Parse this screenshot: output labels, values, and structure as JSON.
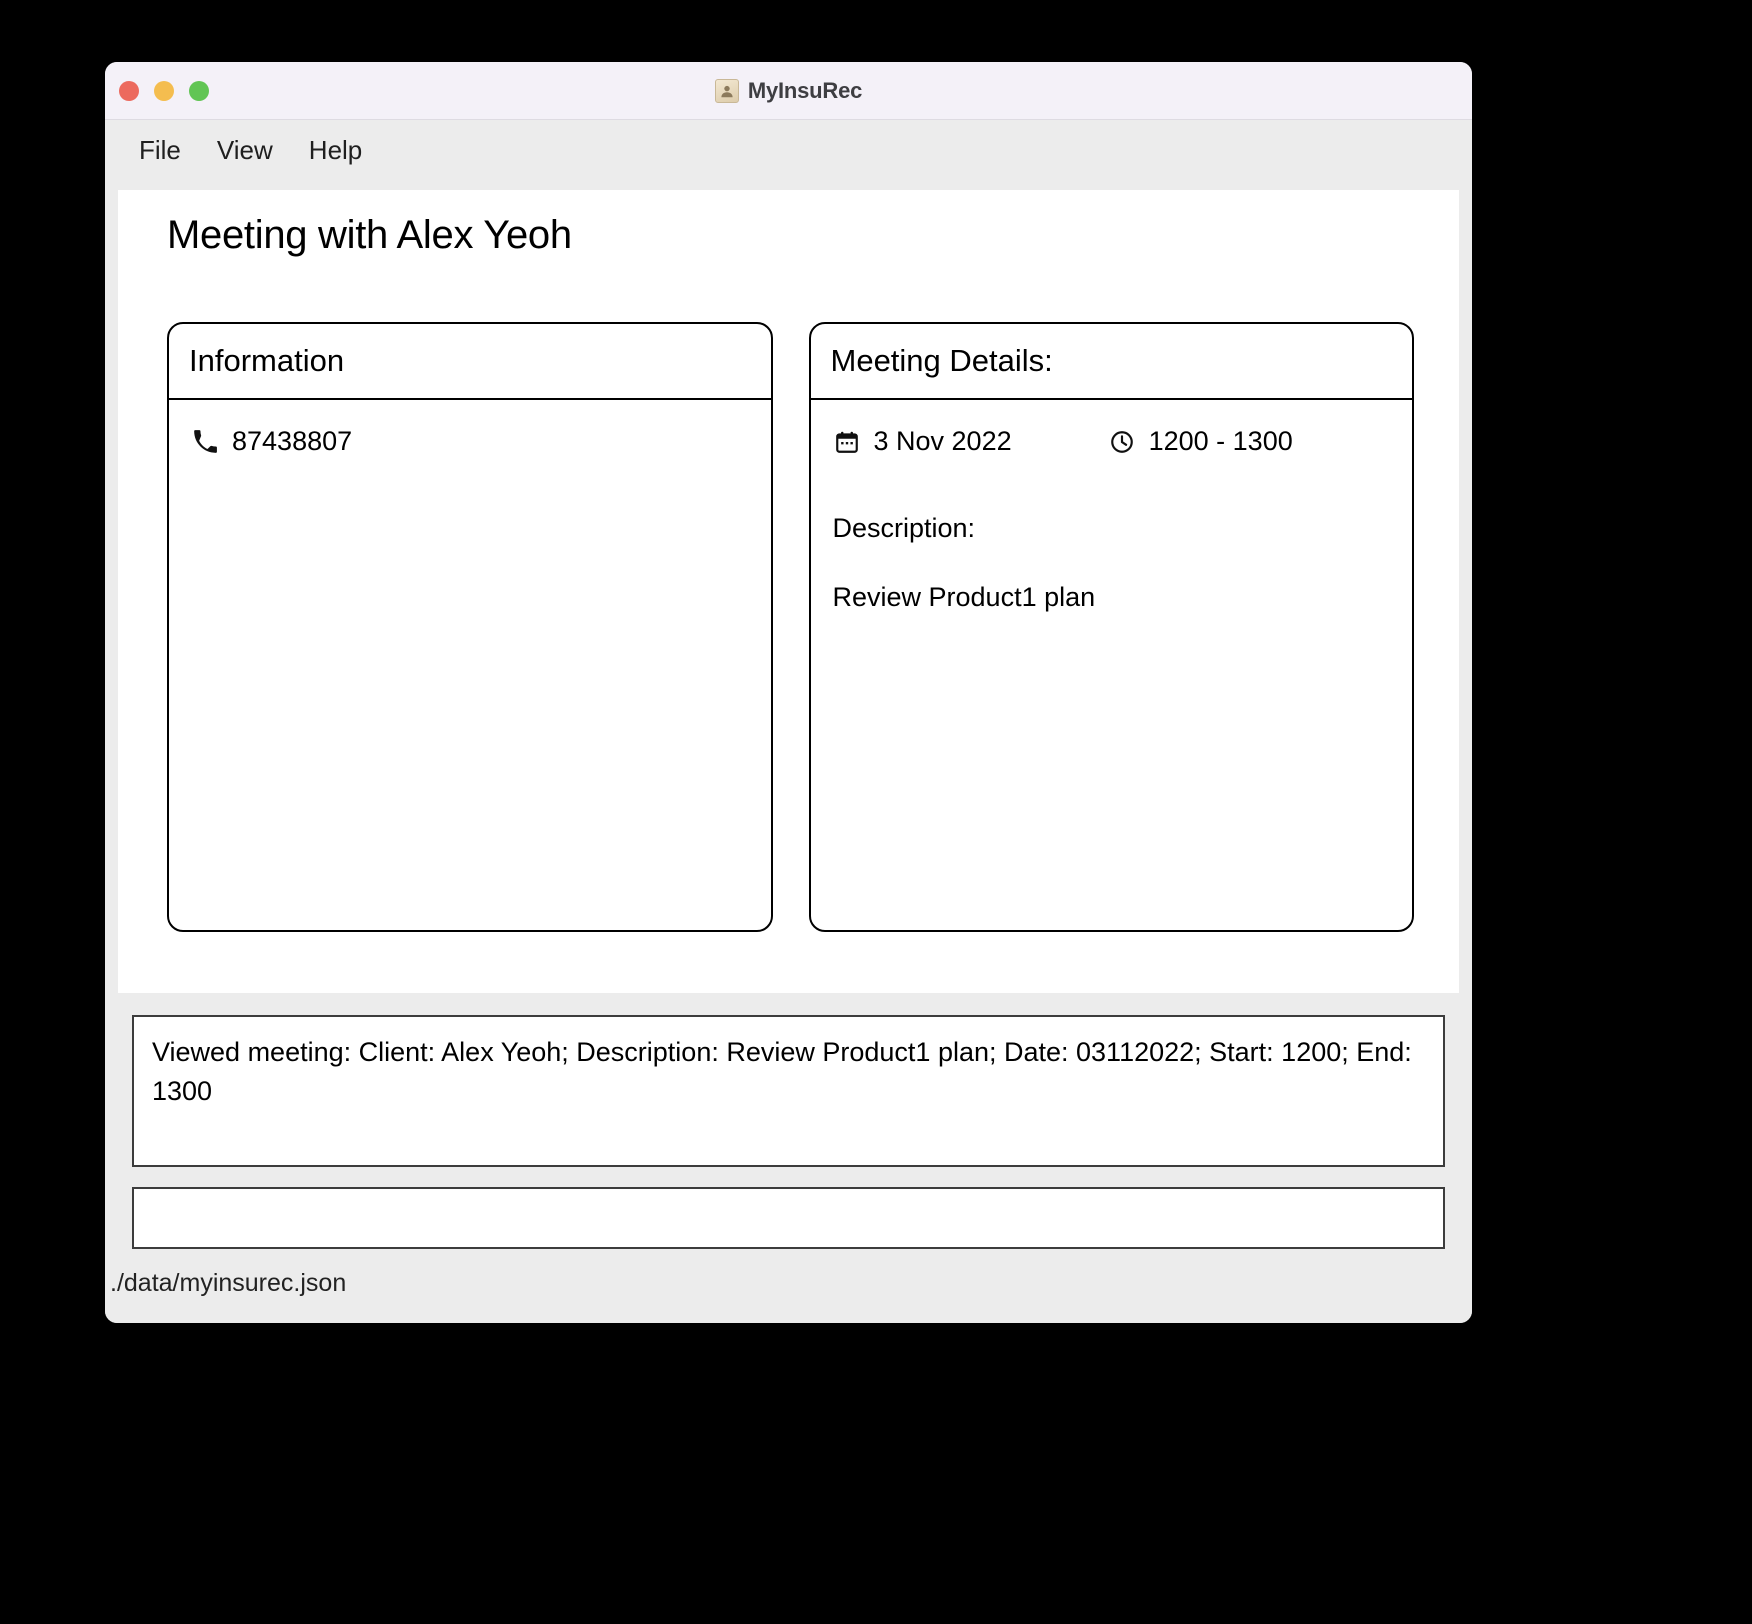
{
  "window": {
    "title": "MyInsuRec",
    "app_icon": "contact-card-icon",
    "controls": {
      "close": "close",
      "minimize": "minimize",
      "maximize": "maximize"
    },
    "colors": {
      "titlebar_bg": "#f4f1f8",
      "menubar_bg": "#ececec",
      "panel_bg": "#ffffff",
      "close_dot": "#ec6a5e",
      "minimize_dot": "#f4bd4f",
      "maximize_dot": "#61c554",
      "border": "#000000"
    }
  },
  "menubar": {
    "items": [
      {
        "label": "File"
      },
      {
        "label": "View"
      },
      {
        "label": "Help"
      }
    ]
  },
  "main": {
    "page_title": "Meeting with Alex Yeoh",
    "information_card": {
      "header": "Information",
      "rows": [
        {
          "icon": "phone-icon",
          "value": "87438807"
        }
      ]
    },
    "meeting_details_card": {
      "header": "Meeting Details:",
      "date": {
        "icon": "calendar-icon",
        "value": "3 Nov 2022"
      },
      "time": {
        "icon": "clock-icon",
        "value": "1200 - 1300"
      },
      "description_label": "Description:",
      "description_value": "Review Product1 plan"
    }
  },
  "footer": {
    "result_text": "Viewed meeting: Client: Alex Yeoh; Description: Review Product1 plan; Date: 03112022; Start: 1200; End: 1300",
    "command_value": "",
    "command_placeholder": "",
    "status_path": "./data/myinsurec.json"
  }
}
